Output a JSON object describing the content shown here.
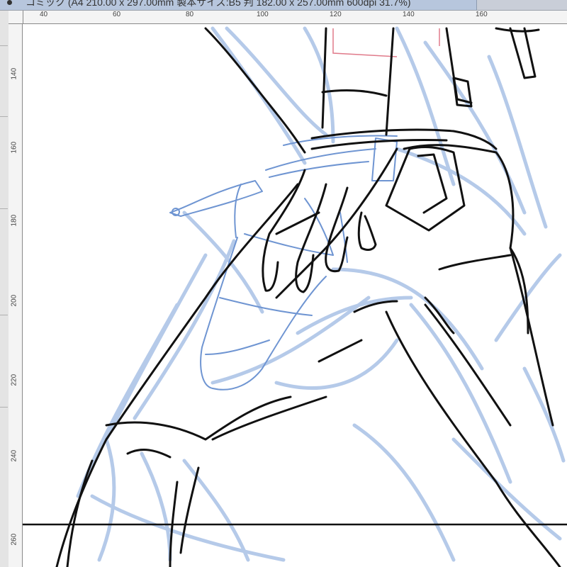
{
  "document_tab": {
    "title": "コミック (A4 210.00 x 297.00mm 製本サイズ:B5 判 182.00 x 257.00mm 600dpi 31.7%)"
  },
  "ruler_horizontal": {
    "labels": [
      "40",
      "60",
      "80",
      "100",
      "120",
      "140",
      "160"
    ]
  },
  "ruler_vertical": {
    "labels": [
      "140",
      "160",
      "180",
      "200",
      "220",
      "240",
      "260"
    ]
  },
  "colors": {
    "sketch_blue": "#a9c1e6",
    "frame_blue": "#6f95d2",
    "ink": "#111111",
    "guide_red": "#e07a8a"
  },
  "canvas": {
    "content": "line-art illustration (legs in jeans, hand on hip)"
  }
}
